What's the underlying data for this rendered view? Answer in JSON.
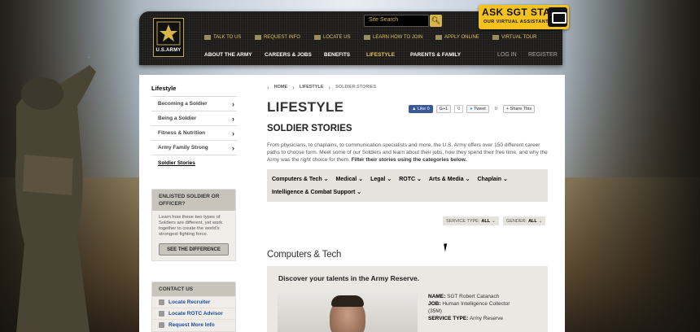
{
  "header": {
    "logo_text": "U.S.ARMY",
    "search_placeholder": "Site Search",
    "utility_links": [
      "TALK TO US",
      "REQUEST INFO",
      "LOCATE US",
      "LEARN HOW TO JOIN",
      "APPLY ONLINE",
      "VIRTUAL TOUR"
    ],
    "main_nav": [
      "ABOUT THE ARMY",
      "CAREERS & JOBS",
      "BENEFITS",
      "LIFESTYLE",
      "PARENTS & FAMILY"
    ],
    "active_nav": "LIFESTYLE",
    "login": "LOG IN",
    "register": "REGISTER"
  },
  "sgt_star": {
    "title": "ASK SGT STAR",
    "subtitle": "OUR VIRTUAL ASSISTANT"
  },
  "sidebar": {
    "title": "Lifestyle",
    "items": [
      {
        "label": "Becoming a Soldier"
      },
      {
        "label": "Being a Soldier"
      },
      {
        "label": "Fitness & Nutrition"
      },
      {
        "label": "Army Family Strong"
      },
      {
        "label": "Soldier Stories"
      }
    ],
    "enlisted_box": {
      "title": "ENLISTED SOLDIER OR OFFICER?",
      "text": "Learn how these two types of Soldiers are different, yet work together to create the world's strongest fighting force.",
      "button": "SEE THE DIFFERENCE"
    },
    "contact": {
      "title": "CONTACT US",
      "links": [
        "Locate Recruiter",
        "Locate ROTC Advisor",
        "Request More Info"
      ]
    }
  },
  "breadcrumb": [
    "HOME",
    "LIFESTYLE",
    "SOLDIER STORIES"
  ],
  "page_title": "LIFESTYLE",
  "share": {
    "like": "Like",
    "like_count": "0",
    "gplus": "G+1",
    "gplus_count": "0",
    "tweet": "Tweet",
    "tweet_count": "0",
    "sharethis": "Share This"
  },
  "subtitle": "SOLDIER STORIES",
  "intro": "From physicians, to chaplains, to communication specialists and more, the U.S. Army offers over 150 different career paths to choose form. Meet some of our Soldiers and learn about their jobs, how they spend their free time, and why the Army was the right choice for them.",
  "intro_bold": "Filter their stories using the categories below.",
  "filters": [
    "Computers & Tech",
    "Medical",
    "Legal",
    "ROTC",
    "Arts & Media",
    "Chaplain",
    "Intelligence & Combat Support"
  ],
  "selects": {
    "service_label": "SERVICE TYPE:",
    "service_value": "ALL",
    "gender_label": "GENDER:",
    "gender_value": "ALL"
  },
  "section_title": "Computers & Tech",
  "card": {
    "heading": "Discover your talents in the Army Reserve.",
    "name_label": "NAME:",
    "name": "SGT Robert Catanach",
    "job_label": "JOB:",
    "job": "Human Intelligence Collector",
    "job_code": "(35M)",
    "service_label": "SERVICE TYPE:",
    "service": "Army Reserve"
  },
  "colors": {
    "accent_gold": "#e7c74f",
    "header_bg": "#1d1c1a",
    "link_blue": "#1a4ea0",
    "sgt_yellow": "#f3c21f"
  }
}
